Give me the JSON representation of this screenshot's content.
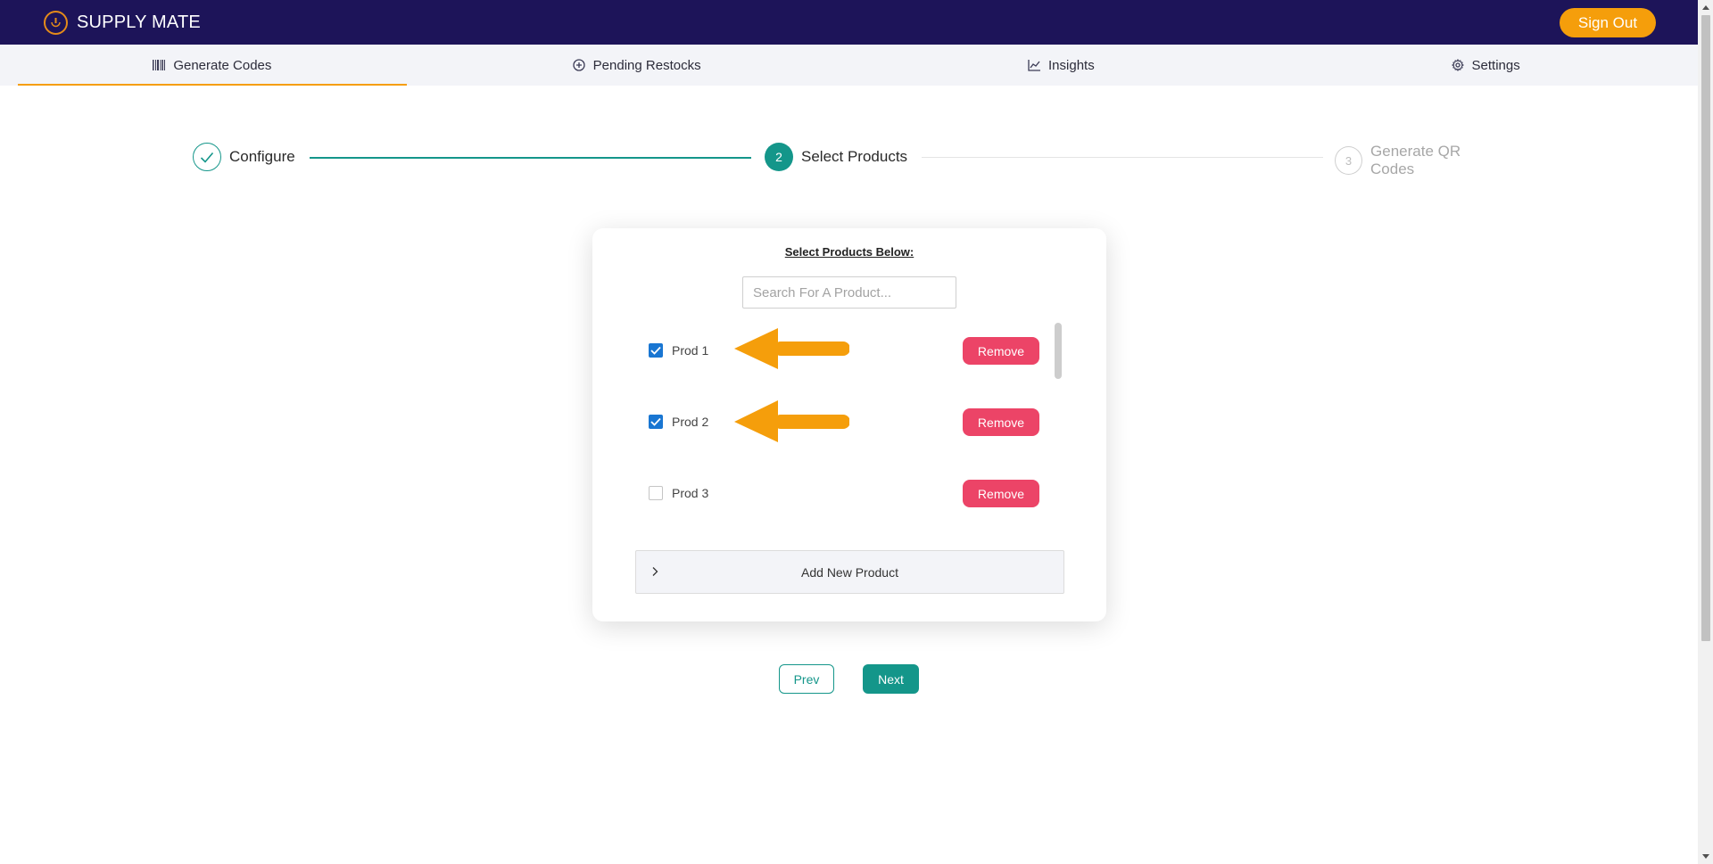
{
  "app": {
    "name": "SUPPLY MATE",
    "sign_out_label": "Sign Out"
  },
  "tabs": [
    {
      "label": "Generate Codes",
      "icon": "barcode-icon",
      "active": true
    },
    {
      "label": "Pending Restocks",
      "icon": "plus-circle-icon",
      "active": false
    },
    {
      "label": "Insights",
      "icon": "line-chart-icon",
      "active": false
    },
    {
      "label": "Settings",
      "icon": "gear-icon",
      "active": false
    }
  ],
  "stepper": {
    "steps": [
      {
        "label": "Configure",
        "status": "completed"
      },
      {
        "number": "2",
        "label": "Select Products",
        "status": "active"
      },
      {
        "number": "3",
        "label": "Generate QR Codes",
        "status": "pending"
      }
    ]
  },
  "product_panel": {
    "title": "Select Products Below:",
    "search_placeholder": "Search For A Product...",
    "products": [
      {
        "label": "Prod 1",
        "checked": true,
        "remove_label": "Remove"
      },
      {
        "label": "Prod 2",
        "checked": true,
        "remove_label": "Remove"
      },
      {
        "label": "Prod 3",
        "checked": false,
        "remove_label": "Remove"
      }
    ],
    "add_new_label": "Add New Product"
  },
  "navigation": {
    "prev_label": "Prev",
    "next_label": "Next"
  },
  "colors": {
    "header_bg": "#1d1459",
    "accent_orange": "#f59e0b",
    "teal": "#14968a",
    "remove_red": "#ec4467",
    "checkbox_blue": "#1976d2"
  }
}
